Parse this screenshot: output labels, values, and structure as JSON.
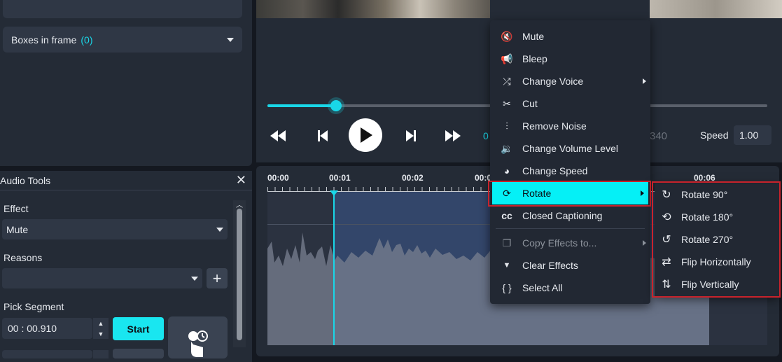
{
  "left_panel": {
    "boxes_label": "Boxes in frame",
    "boxes_count": "(0)"
  },
  "audio_tools": {
    "title": "Audio Tools",
    "close_glyph": "✕",
    "effect_label": "Effect",
    "effect_value": "Mute",
    "reasons_label": "Reasons",
    "reasons_value": "",
    "add_glyph": "+",
    "pick_segment_label": "Pick Segment",
    "segment_time": "00 : 00.910",
    "start_label": "Start"
  },
  "player": {
    "current_time": "0",
    "total_time": "340",
    "speed_label": "Speed",
    "speed_value": "1.00",
    "progress_fraction": 0.137
  },
  "timeline": {
    "ticks": [
      "00:00",
      "00:01",
      "00:02",
      "00:0",
      "00:06"
    ]
  },
  "context_menu": {
    "items": [
      {
        "label": "Mute",
        "icon": "mute-icon",
        "glyph": "🔇"
      },
      {
        "label": "Bleep",
        "icon": "megaphone-icon",
        "glyph": "📢"
      },
      {
        "label": "Change Voice",
        "icon": "shuffle-icon",
        "glyph": "⤮"
      },
      {
        "label": "Cut",
        "icon": "scissors-icon",
        "glyph": "✂"
      },
      {
        "label": "Remove Noise",
        "icon": "waveform-icon",
        "glyph": "⫶"
      },
      {
        "label": "Change Volume Level",
        "icon": "volume-icon",
        "glyph": "🔉"
      },
      {
        "label": "Change Speed",
        "icon": "palette-icon",
        "glyph": "◕"
      },
      {
        "label": "Rotate",
        "icon": "rotate-icon",
        "glyph": "⟳"
      },
      {
        "label": "Closed Captioning",
        "icon": "cc-icon",
        "glyph": "cc"
      },
      {
        "label": "Copy Effects to...",
        "icon": "copy-icon",
        "glyph": "❐"
      },
      {
        "label": "Clear Effects",
        "icon": "eraser-icon",
        "glyph": "▼"
      },
      {
        "label": "Select All",
        "icon": "braces-icon",
        "glyph": "{ }"
      }
    ]
  },
  "rotate_submenu": {
    "items": [
      {
        "label": "Rotate 90°",
        "icon": "rotate-cw-icon",
        "glyph": "↻"
      },
      {
        "label": "Rotate 180°",
        "icon": "rotate-both-icon",
        "glyph": "⟲"
      },
      {
        "label": "Rotate 270°",
        "icon": "rotate-ccw-icon",
        "glyph": "↺"
      },
      {
        "label": "Flip Horizontally",
        "icon": "flip-horizontal-icon",
        "glyph": "⇄"
      },
      {
        "label": "Flip Vertically",
        "icon": "flip-vertical-icon",
        "glyph": "⇅"
      }
    ]
  },
  "colors": {
    "accent": "#19d7e8",
    "highlight_border": "#c8232c",
    "active_item": "#05f0f6"
  }
}
